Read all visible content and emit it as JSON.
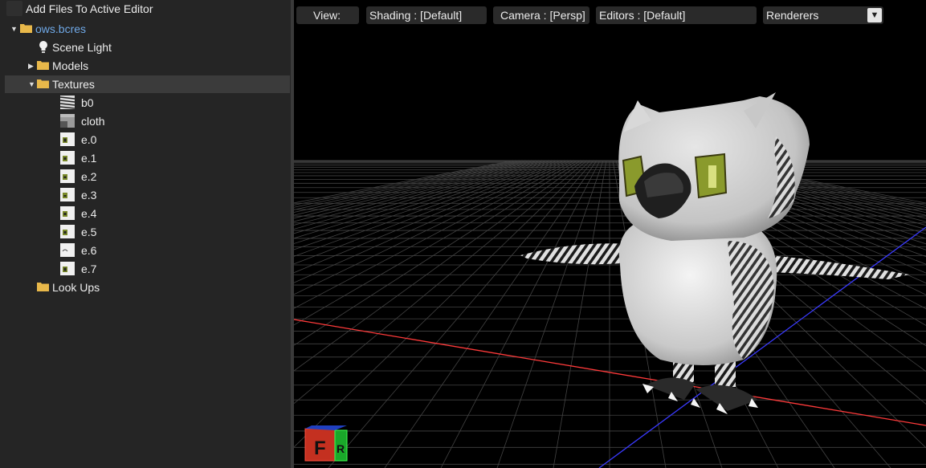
{
  "left_panel": {
    "add_files_label": "Add Files To Active Editor",
    "root_file": "ows.bcres",
    "items": [
      {
        "label": "Scene Light",
        "icon": "light-bulb-icon"
      },
      {
        "label": "Models",
        "icon": "folder-icon"
      },
      {
        "label": "Textures",
        "icon": "folder-icon"
      },
      {
        "label": "Look Ups",
        "icon": "folder-icon"
      }
    ],
    "textures": [
      "b0",
      "cloth",
      "e.0",
      "e.1",
      "e.2",
      "e.3",
      "e.4",
      "e.5",
      "e.6",
      "e.7"
    ]
  },
  "viewport": {
    "view_label": "View:",
    "shading_label": "Shading : [Default]",
    "camera_label": "Camera : [Persp]",
    "editors_label": "Editors : [Default]",
    "renderers_label": "Renderers",
    "gizmo_front_letter": "F",
    "gizmo_right_letter": "R"
  },
  "colors": {
    "panel_bg": "#252525",
    "selected_row": "#3b3b3b",
    "file_link": "#6fa8e6",
    "folder": "#e8b84a",
    "x_axis": "#ff3a3a",
    "z_axis": "#3a3aff"
  }
}
